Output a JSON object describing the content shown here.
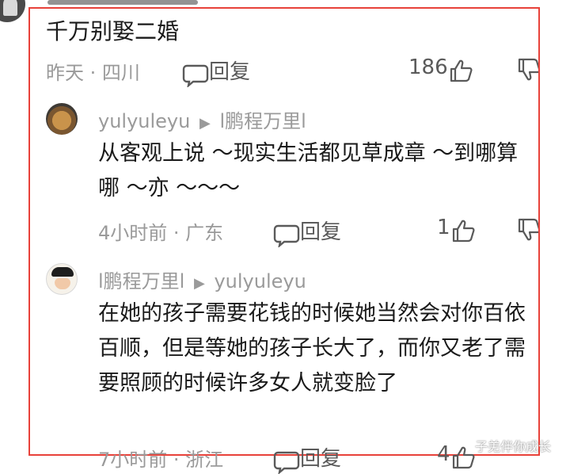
{
  "top_comment": {
    "text": "千万别娶二婚",
    "meta": "昨天 · 四川",
    "reply_label": "回复",
    "likes": "186"
  },
  "replies": [
    {
      "user": "yulyuleyu",
      "arrow": "▶",
      "target": "l鹏程万里l",
      "text": "从客观上说 ～现实生活都见草成章 ～到哪算哪 ～亦 ～～～",
      "meta": "4小时前 · 广东",
      "reply_label": "回复",
      "likes": "1"
    },
    {
      "user": "l鹏程万里l",
      "arrow": "▶",
      "target": "yulyuleyu",
      "text": "在她的孩子需要花钱的时候她当然会对你百依百顺，但是等她的孩子长大了，而你又老了需要照顾的时候许多女人就变脸了",
      "meta": "7小时前 · 浙江",
      "reply_label": "回复",
      "likes": "4"
    }
  ],
  "watermark": "子羌伴你成长",
  "colors": {
    "frame": "#e8423a",
    "meta_gray": "#9a9a9a",
    "text": "#1a1a1a"
  },
  "icons": [
    "comment-bubble-icon",
    "thumbs-up-icon",
    "thumbs-down-icon"
  ]
}
